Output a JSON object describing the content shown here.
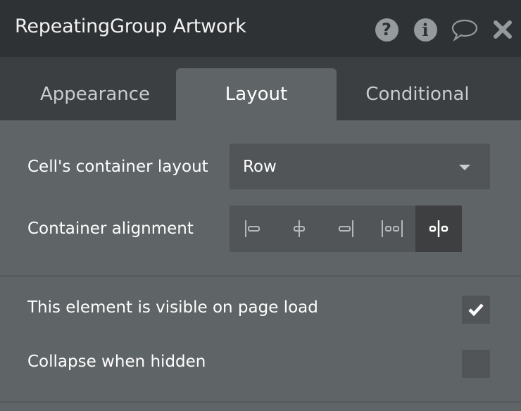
{
  "header": {
    "title": "RepeatingGroup Artwork",
    "icons": [
      "help-icon",
      "info-icon",
      "comment-icon",
      "close-icon"
    ]
  },
  "tabs": [
    {
      "label": "Appearance",
      "active": false
    },
    {
      "label": "Layout",
      "active": true
    },
    {
      "label": "Conditional",
      "active": false
    }
  ],
  "layout": {
    "container_layout_label": "Cell's container layout",
    "container_layout_value": "Row",
    "alignment_label": "Container alignment",
    "alignment_options": [
      "align-left",
      "align-center",
      "align-right",
      "space-between",
      "space-around"
    ],
    "alignment_selected": "space-around"
  },
  "visibility": {
    "visible_label": "This element is visible on page load",
    "visible_checked": true,
    "collapse_label": "Collapse when hidden",
    "collapse_checked": false
  }
}
